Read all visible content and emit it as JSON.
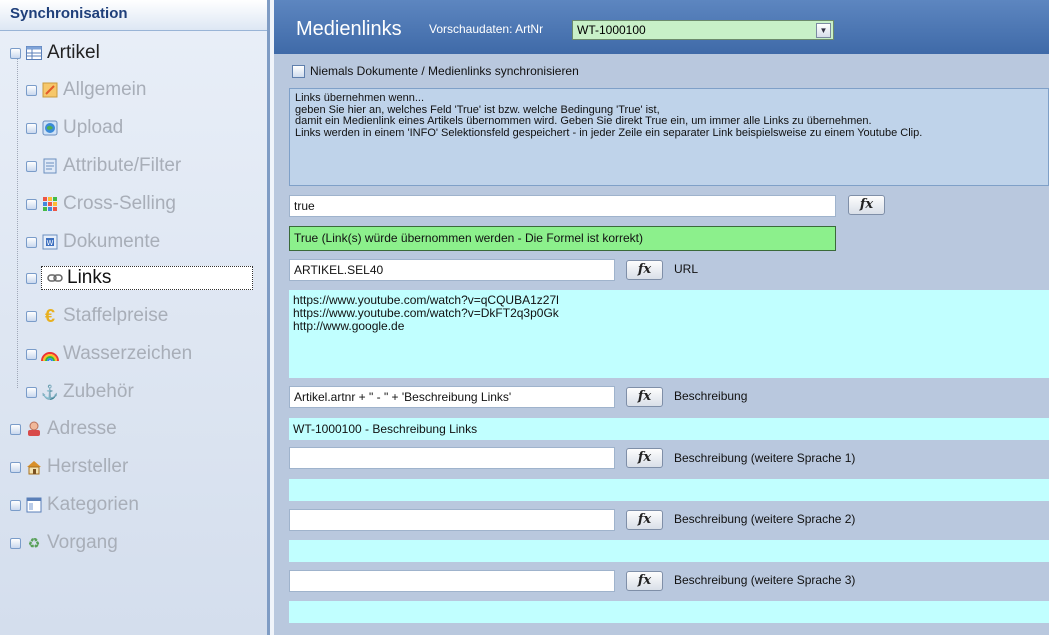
{
  "sidebar": {
    "title": "Synchronisation",
    "items": [
      {
        "label": "Artikel",
        "icon": "table-icon"
      },
      {
        "label": "Allgemein",
        "icon": "pencil-icon"
      },
      {
        "label": "Upload",
        "icon": "globe-icon"
      },
      {
        "label": "Attribute/Filter",
        "icon": "note-icon"
      },
      {
        "label": "Cross-Selling",
        "icon": "grid-icon"
      },
      {
        "label": "Dokumente",
        "icon": "document-icon"
      },
      {
        "label": "Links",
        "icon": "link-icon"
      },
      {
        "label": "Staffelpreise",
        "icon": "euro-icon"
      },
      {
        "label": "Wasserzeichen",
        "icon": "rainbow-icon"
      },
      {
        "label": "Zubehör",
        "icon": "anchor-icon"
      },
      {
        "label": "Adresse",
        "icon": "person-icon"
      },
      {
        "label": "Hersteller",
        "icon": "house-icon"
      },
      {
        "label": "Kategorien",
        "icon": "window-icon"
      },
      {
        "label": "Vorgang",
        "icon": "recycle-icon"
      }
    ]
  },
  "header": {
    "title": "Medienlinks",
    "preview_label": "Vorschaudaten: ArtNr",
    "preview_value": "WT-1000100"
  },
  "never_sync_label": "Niemals Dokumente / Medienlinks synchronisieren",
  "info_lines": [
    "Links übernehmen wenn...",
    "geben Sie hier an, welches Feld 'True' ist bzw. welche Bedingung 'True' ist,",
    "damit ein Medienlink eines Artikels übernommen wird. Geben Sie direkt True ein, um immer alle Links zu übernehmen.",
    "Links werden in einem 'INFO' Selektionsfeld gespeichert - in jeder Zeile ein separater Link beispielsweise zu einem Youtube Clip."
  ],
  "condition_value": "true",
  "condition_status": "True (Link(s) würde übernommen werden - Die Formel ist korrekt)",
  "url_field": {
    "value": "ARTIKEL.SEL40",
    "label": "URL"
  },
  "url_preview": [
    "https://www.youtube.com/watch?v=qCQUBA1z27l",
    "https://www.youtube.com/watch?v=DkFT2q3p0Gk",
    "http://www.google.de"
  ],
  "desc_field": {
    "value": "Artikel.artnr + \" - \" + 'Beschreibung Links'",
    "label": "Beschreibung",
    "preview": "WT-1000100 - Beschreibung Links"
  },
  "desc2_field": {
    "value": "",
    "label": "Beschreibung (weitere Sprache 1)",
    "preview": ""
  },
  "desc3_field": {
    "value": "",
    "label": "Beschreibung (weitere Sprache 2)",
    "preview": ""
  },
  "desc4_field": {
    "value": "",
    "label": "Beschreibung (weitere Sprache 3)",
    "preview": ""
  },
  "fx_label": "fx"
}
